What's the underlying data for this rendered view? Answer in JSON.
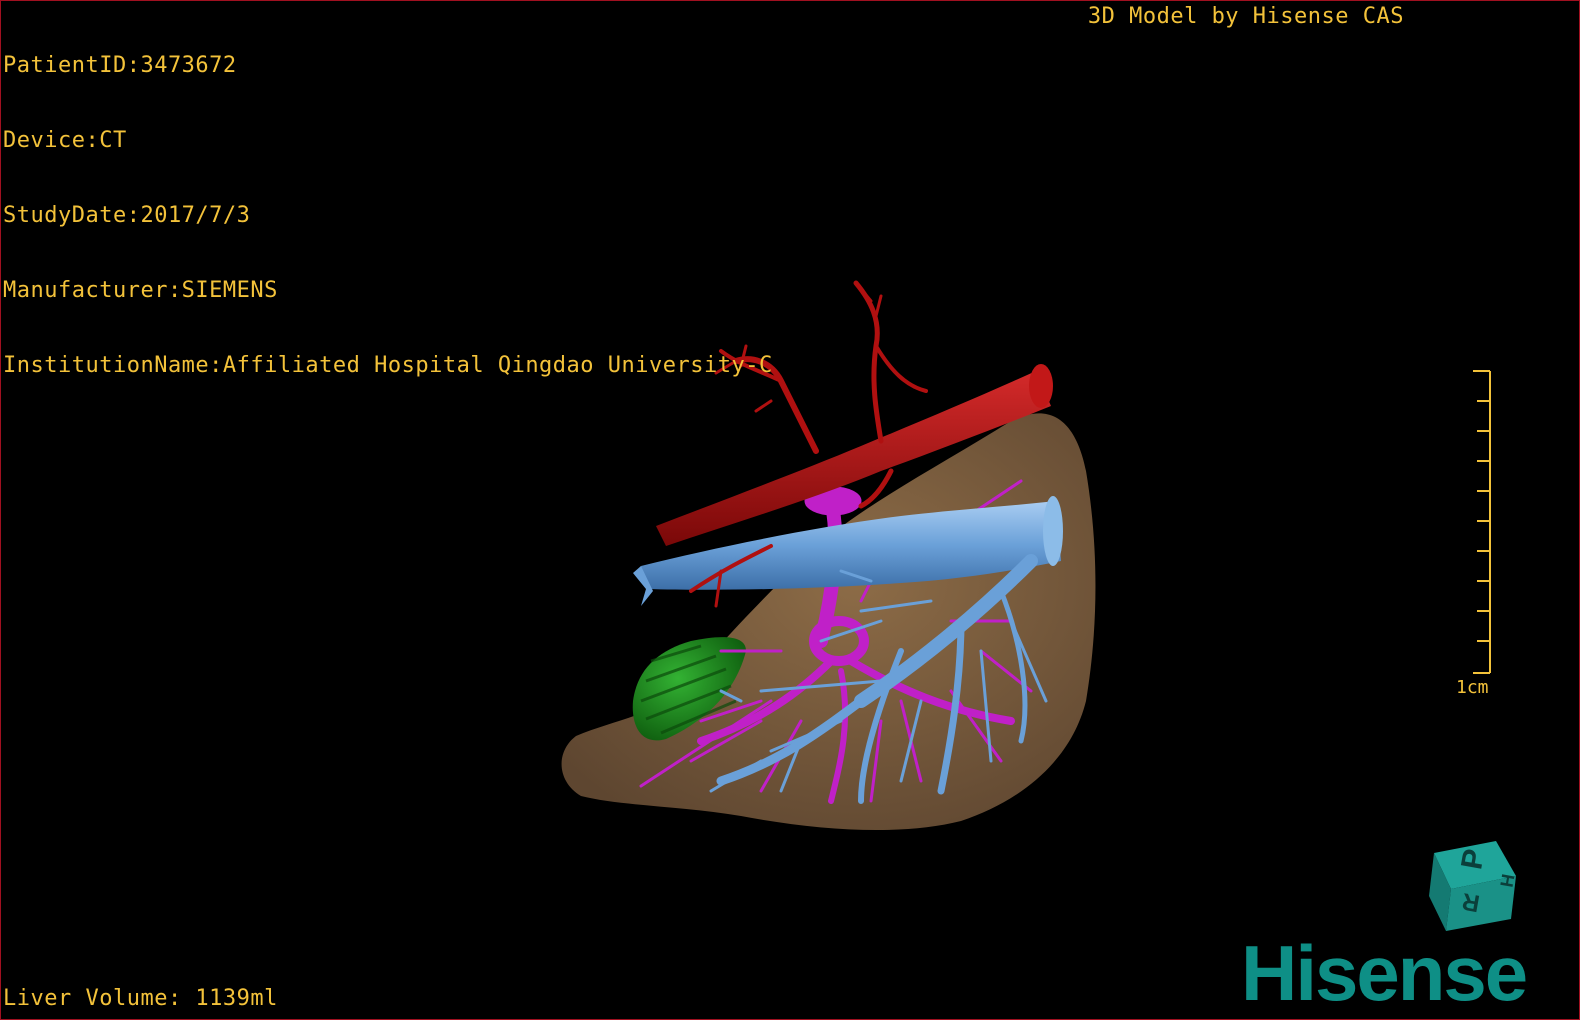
{
  "dicom": {
    "patient_id": "PatientID:3473672",
    "device": "Device:CT",
    "study_date": "StudyDate:2017/7/3",
    "manufacturer": "Manufacturer:SIEMENS",
    "institution": "InstitutionName:Affiliated Hospital Qingdao University-C"
  },
  "brand_caption": "3D Model by Hisense CAS",
  "liver_volume": "Liver Volume: 1139ml",
  "scale_bar": {
    "label": "1cm"
  },
  "orientation_cube": {
    "labels": [
      "P",
      "R",
      "H"
    ]
  },
  "logo": {
    "text": "Hisense"
  },
  "colors": {
    "overlay_text": "#f3c23a",
    "liver": "#7a5e3e",
    "artery": "#b01010",
    "portal_vein": "#c020c8",
    "hepatic_vein": "#6aa0d8",
    "gallbladder": "#1a8a1a",
    "logo": "#0e8f86",
    "border": "#a01020"
  }
}
